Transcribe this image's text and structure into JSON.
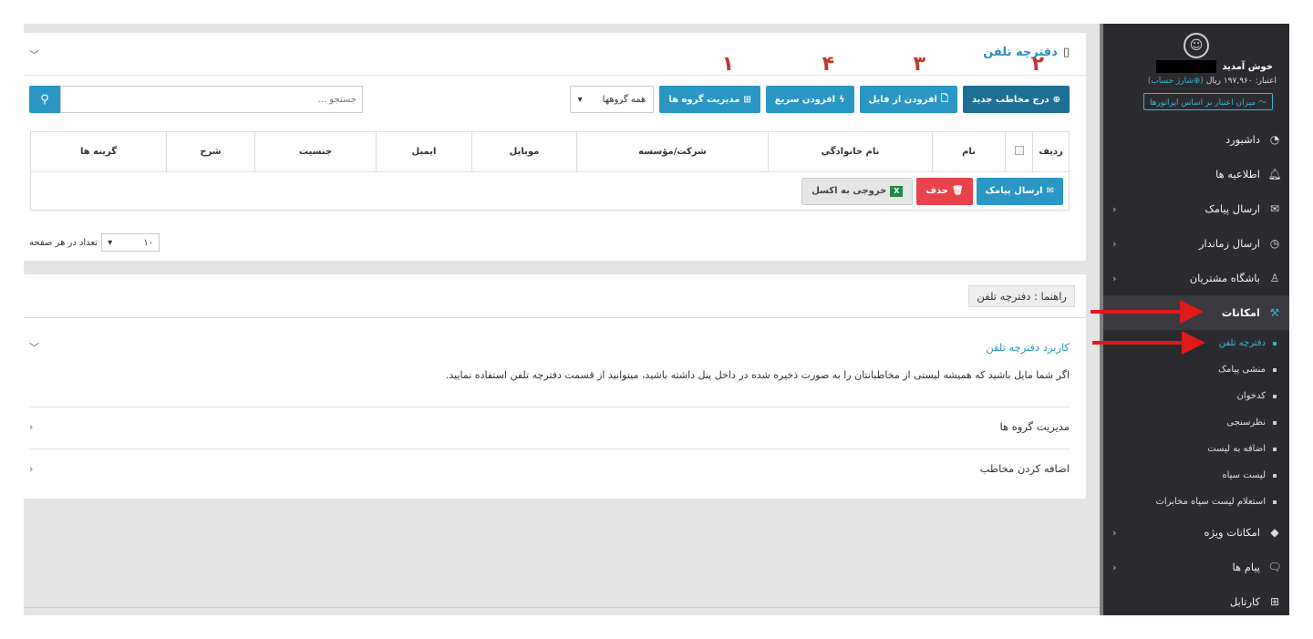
{
  "sidebar": {
    "welcome": "خوش آمدید",
    "credit_text": "اعتبار: ۱۹۷,۹۶۰ ریال",
    "credit_link": "(⊕شارژ حساب)",
    "credit_operators": "〜 میزان اعتبار بر اساس اپراتورها",
    "items": [
      {
        "label": "داشبورد",
        "icon": "dashboard-icon"
      },
      {
        "label": "اطلاعیه ها",
        "icon": "bell-icon"
      },
      {
        "label": "ارسال پیامک",
        "icon": "sms-icon"
      },
      {
        "label": "ارسال زماندار",
        "icon": "clock-icon"
      },
      {
        "label": "باشگاه مشتریان",
        "icon": "users-icon"
      },
      {
        "label": "امکانات",
        "icon": "tools-icon"
      }
    ],
    "submenu": [
      {
        "label": "دفترچه تلفن"
      },
      {
        "label": "منشی پیامک"
      },
      {
        "label": "کدخوان"
      },
      {
        "label": "نظرسنجی"
      },
      {
        "label": "اضافه به لیست"
      },
      {
        "label": "لیست سیاه"
      },
      {
        "label": "استعلام لیست سیاه مخابرات"
      }
    ],
    "items_after": [
      {
        "label": "امکانات ویژه",
        "icon": "diamond-icon"
      },
      {
        "label": "پیام ها",
        "icon": "chat-icon"
      },
      {
        "label": "کارتابل",
        "icon": "grid-icon"
      }
    ]
  },
  "phonebook": {
    "title": "دفترچه تلفن",
    "buttons": {
      "new_contact": "درج مخاطب جدید",
      "from_file": "افزودن از فایل",
      "quick_add": "افزودن سریع",
      "groups": "مدیریت گروه ها"
    },
    "group_select": "همه گروهها",
    "search_placeholder": "جستجو ...",
    "annotations": [
      "۲",
      "۳",
      "۴",
      "۱"
    ],
    "columns": [
      "ردیف",
      "نام",
      "نام خانوادگی",
      "شرکت/مؤسسه",
      "موبایل",
      "ایمیل",
      "جنسیت",
      "شرح",
      "گزینه ها"
    ],
    "row_actions": {
      "send_sms": "ارسال پیامک",
      "delete": "حذف",
      "export_excel": "خروجی به اکسل"
    },
    "per_page_label": "تعداد در هر صفحه",
    "per_page_value": "۱۰"
  },
  "help": {
    "title": "راهنما : دفترچه تلفن",
    "sections": [
      {
        "title": "کاربرد دفترچه تلفن",
        "body": "اگر شما مایل باشید که همیشه لیستی از مخاطبانتان را به صورت ذخیره شده در داخل پنل داشته باشید، میتوانید از قسمت دفترچه تلفن استفاده نمایید."
      },
      {
        "title": "مدیریت گروه ها"
      },
      {
        "title": "اضافه کردن مخاطب"
      }
    ]
  },
  "colors": {
    "sidebar_bg": "#2b2b2f",
    "accent": "#2a97c4",
    "dark_button": "#1e6f94",
    "danger": "#e8434b",
    "annotation": "#c0392b",
    "arrow": "#e01919"
  }
}
